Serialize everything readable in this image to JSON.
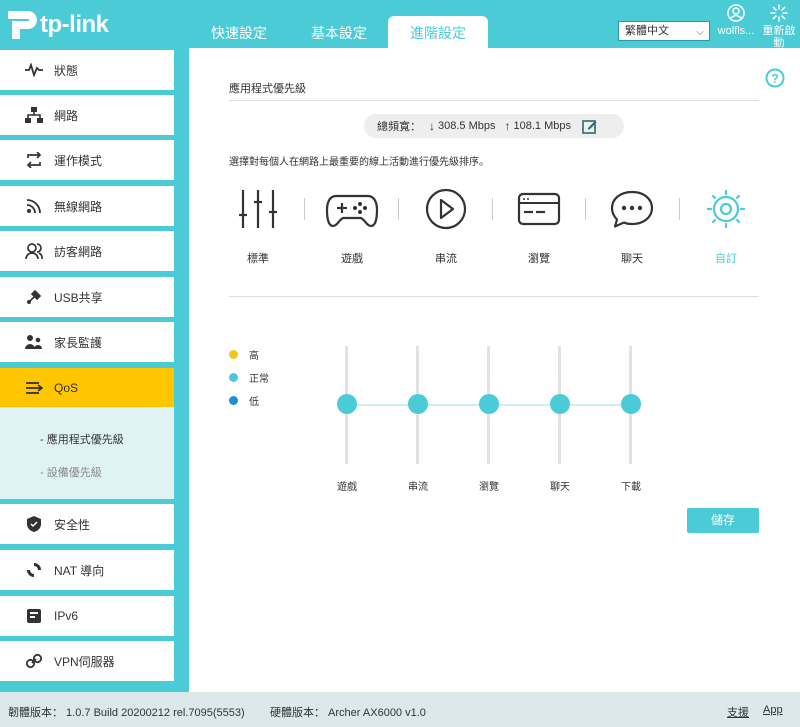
{
  "header": {
    "brand": "tp-link",
    "tabs": [
      {
        "label": "快速設定"
      },
      {
        "label": "基本設定"
      },
      {
        "label": "進階設定"
      }
    ],
    "language": "繁體中文",
    "user": "wolfls...",
    "reboot_label": "重新啟動"
  },
  "sidebar": {
    "items": [
      {
        "label": "狀態",
        "icon": "status-icon"
      },
      {
        "label": "網路",
        "icon": "network-icon"
      },
      {
        "label": "運作模式",
        "icon": "mode-icon"
      },
      {
        "label": "無線網路",
        "icon": "wireless-icon"
      },
      {
        "label": "訪客網路",
        "icon": "guest-icon"
      },
      {
        "label": "USB共享",
        "icon": "usb-icon"
      },
      {
        "label": "家長監護",
        "icon": "parental-icon"
      },
      {
        "label": "QoS",
        "icon": "qos-icon"
      },
      {
        "label": "安全性",
        "icon": "shield-icon"
      },
      {
        "label": "NAT 導向",
        "icon": "nat-icon"
      },
      {
        "label": "IPv6",
        "icon": "ipv6-icon"
      },
      {
        "label": "VPN伺服器",
        "icon": "vpn-icon"
      }
    ],
    "sub_items": [
      {
        "label": "- 應用程式優先級"
      },
      {
        "label": "- 設備優先級"
      }
    ]
  },
  "content": {
    "title": "應用程式優先級",
    "bandwidth_label": "總頻寬：",
    "download": "308.5 Mbps",
    "upload": "108.1 Mbps",
    "instruction": "選擇對每個人在網路上最重要的線上活動進行優先級排序。",
    "categories": [
      {
        "label": "標準",
        "icon": "standard-icon"
      },
      {
        "label": "遊戲",
        "icon": "gamepad-icon"
      },
      {
        "label": "串流",
        "icon": "play-icon"
      },
      {
        "label": "瀏覽",
        "icon": "browser-icon"
      },
      {
        "label": "聊天",
        "icon": "chat-icon"
      },
      {
        "label": "自訂",
        "icon": "custom-icon"
      }
    ],
    "selected_category": "自訂",
    "legend": [
      {
        "label": "高",
        "color": "#f5c518"
      },
      {
        "label": "正常",
        "color": "#4acbd6"
      },
      {
        "label": "低",
        "color": "#1e8fd6"
      }
    ],
    "sliders": [
      {
        "label": "遊戲",
        "level": "正常"
      },
      {
        "label": "串流",
        "level": "正常"
      },
      {
        "label": "瀏覽",
        "level": "正常"
      },
      {
        "label": "聊天",
        "level": "正常"
      },
      {
        "label": "下載",
        "level": "正常"
      }
    ],
    "save_label": "儲存"
  },
  "footer": {
    "firmware": "韌體版本： 1.0.7 Build 20200212 rel.7095(5553)",
    "hardware": "硬體版本： Archer AX6000 v1.0",
    "support": "支援",
    "app": "App"
  },
  "colors": {
    "accent": "#4acbd6",
    "active": "#ffc600"
  }
}
